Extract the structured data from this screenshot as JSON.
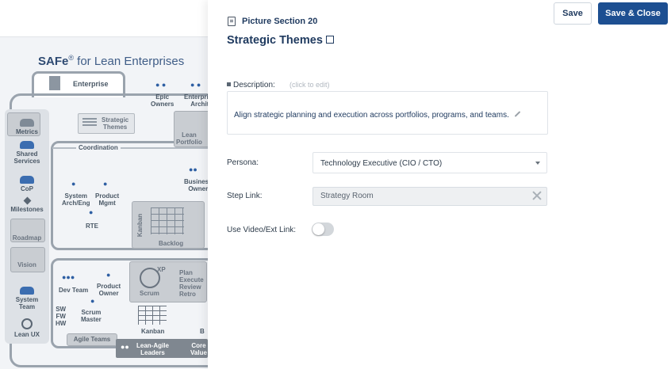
{
  "background": {
    "title_brand": "SAFe",
    "title_mark": "®",
    "title_rest": " for Lean Enterprises",
    "labels": {
      "enterprise": "Enterprise",
      "epic_owners": "Epic\nOwners",
      "enterprise_architect": "Enterprise\nArchit",
      "strategic_themes": "Strategic\nThemes",
      "lean_portfolio": "Lean\nPortfolio",
      "coordination": "Coordination",
      "business_owners": "Business\nOwner",
      "system_arch": "System\nArch/Eng",
      "product_mgmt": "Product\nMgmt",
      "rte": "RTE",
      "kanban_vertical": "Kanban",
      "backlog": "Backlog",
      "dev_team": "Dev Team",
      "product_owner": "Product\nOwner",
      "scrum_master": "Scrum\nMaster",
      "sw_fw_hw": "SW\nFW\nHW",
      "scrum": "Scrum",
      "scrum_steps": "Plan\nExecute\nReview\nRetro",
      "xp": "XP",
      "kanban": "Kanban",
      "agile_teams": "Agile Teams",
      "lean_agile_leaders": "Lean-Agile\nLeaders",
      "core_values": "Core\nValue",
      "b_cut": "B"
    },
    "sidebar": [
      "Metrics",
      "Shared\nServices",
      "CoP",
      "Milestones",
      "Roadmap",
      "Vision",
      "System\nTeam",
      "Lean UX"
    ]
  },
  "panel": {
    "section_label": "Picture Section 20",
    "save_label": "Save",
    "save_close_label": "Save & Close",
    "title": "Strategic Themes",
    "description_label": "Description:",
    "click_to_edit": "(click to edit)",
    "description_text": "Align strategic planning and execution across portfolios, programs, and teams.",
    "persona_label": "Persona:",
    "persona_value": "Technology Executive (CIO / CTO)",
    "step_link_label": "Step Link:",
    "step_link_value": "Strategy Room",
    "video_label": "Use Video/Ext Link:",
    "video_enabled": false
  }
}
